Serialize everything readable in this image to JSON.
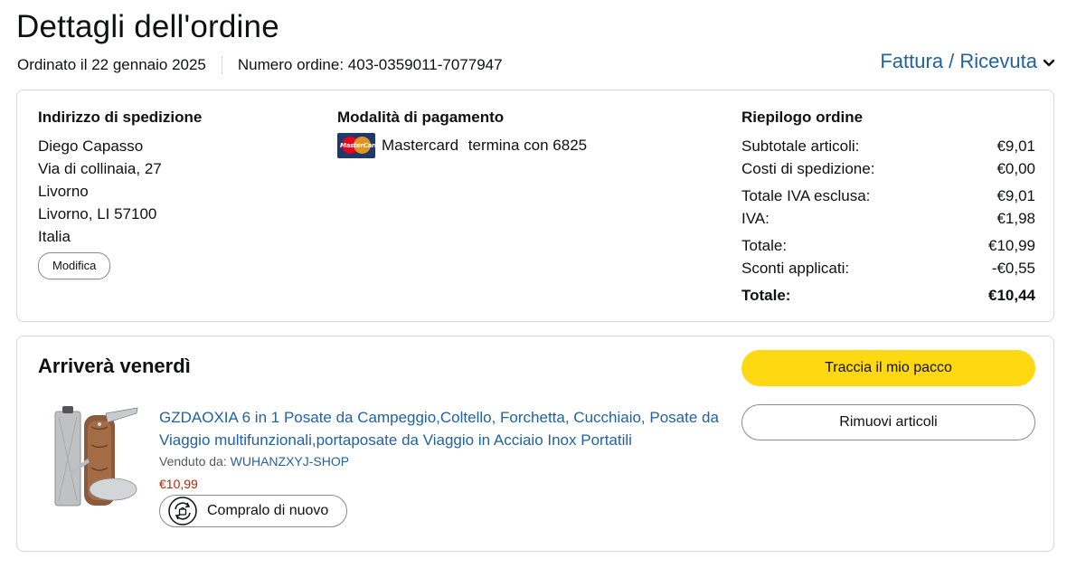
{
  "header": {
    "title": "Dettagli dell'ordine",
    "ordered_on": "Ordinato il 22 gennaio 2025",
    "order_number": "Numero ordine: 403-0359011-7077947",
    "invoice_label": "Fattura / Ricevuta"
  },
  "shipping": {
    "heading": "Indirizzo di spedizione",
    "lines": [
      "Diego Capasso",
      "Via di collinaia, 27",
      "Livorno",
      "Livorno, LI 57100",
      "Italia"
    ],
    "edit_label": "Modifica"
  },
  "payment": {
    "heading": "Modalità di pagamento",
    "card_brand": "Mastercard",
    "card_ending": "termina con 6825",
    "card_logo_text": "MasterCard"
  },
  "summary": {
    "heading": "Riepilogo ordine",
    "rows": [
      {
        "label": "Subtotale articoli:",
        "value": "€9,01"
      },
      {
        "label": "Costi di spedizione:",
        "value": "€0,00"
      },
      {
        "label": "Totale IVA esclusa:",
        "value": "€9,01"
      },
      {
        "label": "IVA:",
        "value": "€1,98"
      },
      {
        "label": "Totale:",
        "value": "€10,99"
      },
      {
        "label": "Sconti applicati:",
        "value": "-€0,55"
      },
      {
        "label": "Totale:",
        "value": "€10,44"
      }
    ]
  },
  "shipment": {
    "arrival": "Arriverà venerdì",
    "track_label": "Traccia il mio pacco",
    "remove_label": "Rimuovi articoli",
    "item": {
      "title": "GZDAOXIA 6 in 1 Posate da Campeggio,Coltello, Forchetta, Cucchiaio, Posate da Viaggio multifunzionali,portaposate da Viaggio in Acciaio Inox Portatili",
      "sold_by_label": "Venduto da:",
      "seller": "WUHANZXYJ-SHOP",
      "price": "€10,99",
      "buy_again_label": "Compralo di nuovo"
    }
  },
  "colors": {
    "link": "#2162a1",
    "price": "#b12704",
    "primary_button": "#ffd814",
    "border": "#d5d9d9"
  },
  "icons": [
    "chevron-down-icon",
    "mastercard-icon",
    "buy-again-icon"
  ]
}
